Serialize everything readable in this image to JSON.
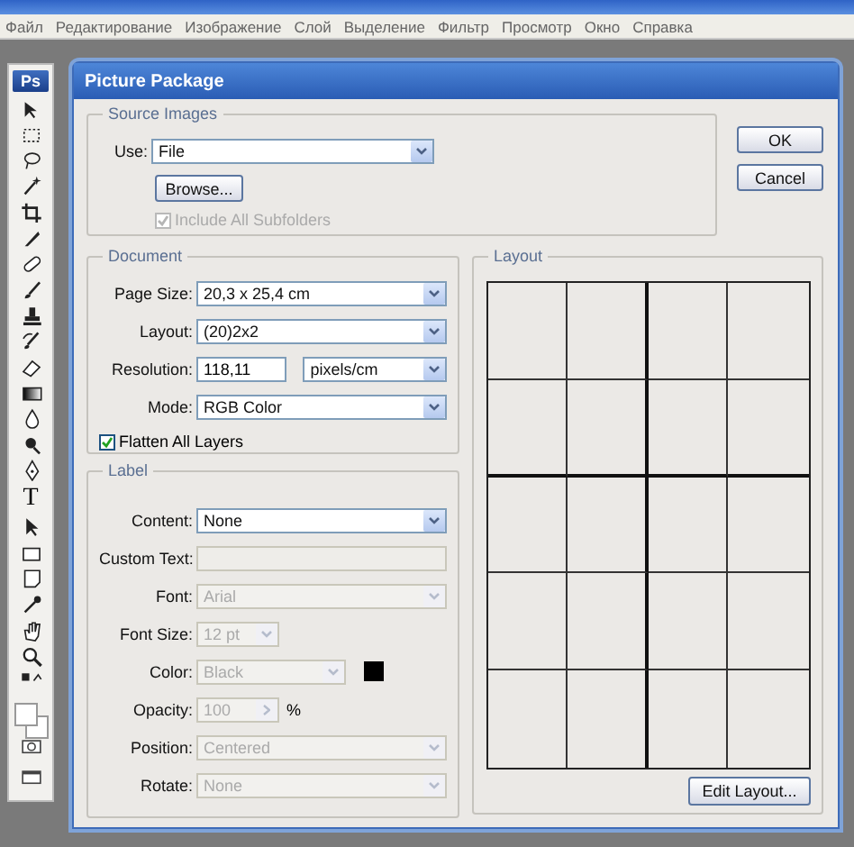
{
  "menu_bar": [
    "Файл",
    "Редактирование",
    "Изображение",
    "Слой",
    "Выделение",
    "Фильтр",
    "Просмотр",
    "Окно",
    "Справка"
  ],
  "toolbox": {
    "logo": "Ps",
    "type_tool": "T"
  },
  "dialog": {
    "title": "Picture Package",
    "source_images": {
      "legend": "Source Images",
      "use": {
        "label": "Use:",
        "value": "File"
      },
      "browse_button": "Browse...",
      "include_subfolders": {
        "label": "Include All Subfolders",
        "checked": true,
        "disabled": true
      }
    },
    "document": {
      "legend": "Document",
      "fields": [
        {
          "kind": "select",
          "label": "Page Size:",
          "value": "20,3 x 25,4 cm",
          "disabled": false
        },
        {
          "kind": "select",
          "label": "Layout:",
          "value": "(20)2x2",
          "disabled": false
        },
        {
          "kind": "number-unit",
          "label": "Resolution:",
          "value": "118,11",
          "unit": "pixels/cm",
          "disabled": false
        },
        {
          "kind": "select",
          "label": "Mode:",
          "value": "RGB Color",
          "disabled": false
        }
      ],
      "flatten": {
        "label": "Flatten All Layers",
        "checked": true,
        "disabled": false
      }
    },
    "label": {
      "legend": "Label",
      "fields": [
        {
          "kind": "select",
          "label": "Content:",
          "value": "None",
          "disabled": false
        },
        {
          "kind": "text",
          "label": "Custom Text:",
          "disabled": true
        },
        {
          "kind": "select",
          "label": "Font:",
          "value": "Arial",
          "disabled": true
        },
        {
          "kind": "select-short",
          "label": "Font Size:",
          "value": "12 pt",
          "disabled": true
        },
        {
          "kind": "color",
          "label": "Color:",
          "value": "Black",
          "disabled": true
        },
        {
          "kind": "spinner",
          "label": "Opacity:",
          "value": "100",
          "unit": "%",
          "disabled": true
        },
        {
          "kind": "select",
          "label": "Position:",
          "value": "Centered",
          "disabled": true
        },
        {
          "kind": "select",
          "label": "Rotate:",
          "value": "None",
          "disabled": true
        }
      ]
    },
    "buttons": [
      {
        "label": "OK"
      },
      {
        "label": "Cancel"
      }
    ],
    "layout": {
      "legend": "Layout",
      "edit_button": "Edit Layout..."
    }
  }
}
